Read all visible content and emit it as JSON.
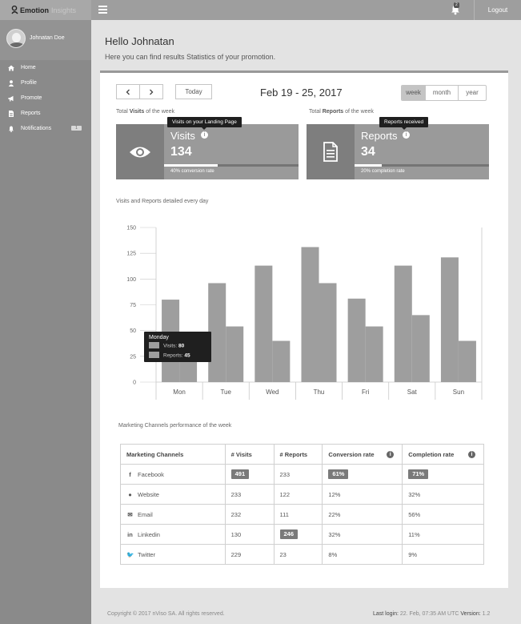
{
  "brand": {
    "name": "Emotion",
    "suffix": "Insights"
  },
  "topbar": {
    "notifications_count": "2",
    "logout_label": "Logout"
  },
  "sidebar": {
    "user_name": "Johnatan Doe",
    "items": [
      {
        "label": "Home",
        "icon": "home-icon"
      },
      {
        "label": "Profile",
        "icon": "user-icon"
      },
      {
        "label": "Promote",
        "icon": "megaphone-icon"
      },
      {
        "label": "Reports",
        "icon": "report-icon"
      },
      {
        "label": "Notifications",
        "icon": "bell-icon",
        "badge": "1"
      }
    ]
  },
  "header": {
    "title": "Hello Johnatan",
    "subtitle": "Here you can find results Statistics of your promotion."
  },
  "controls": {
    "prev": "‹",
    "next": "›",
    "today": "Today",
    "date_range": "Feb 19 - 25, 2017",
    "periods": [
      "week",
      "month",
      "year"
    ],
    "active_period": "week"
  },
  "visits": {
    "total_label_pre": "Total ",
    "total_label_bold": "Visits",
    "total_label_post": " of the week",
    "title": "Visits",
    "value": "134",
    "caption": "40% conversion rate",
    "progress": 0.4,
    "tooltip": "Visits on your Landing Page"
  },
  "reports": {
    "total_label_pre": "Total ",
    "total_label_bold": "Reports",
    "total_label_post": " of the week",
    "title": "Reports",
    "value": "34",
    "caption": "20% completion rate",
    "progress": 0.2,
    "tooltip": "Reports received"
  },
  "chart_title": "Visits and Reports detailed every day",
  "chart_data": {
    "type": "bar",
    "categories": [
      "Mon",
      "Tue",
      "Wed",
      "Thu",
      "Fri",
      "Sat",
      "Sun"
    ],
    "series": [
      {
        "name": "Visits",
        "values": [
          80,
          96,
          113,
          131,
          81,
          113,
          121
        ],
        "color": "#9e9e9e"
      },
      {
        "name": "Reports",
        "values": [
          45,
          54,
          40,
          96,
          54,
          65,
          40
        ],
        "color": "#9e9e9e"
      }
    ],
    "ylim": [
      0,
      150
    ],
    "yticks": [
      0,
      25,
      50,
      75,
      100,
      125,
      150
    ],
    "grid": false,
    "tooltip": {
      "day": "Monday",
      "rows": [
        {
          "label": "Visits:",
          "value": "80"
        },
        {
          "label": "Reports:",
          "value": "45"
        }
      ]
    }
  },
  "table": {
    "title": "Marketing Channels performance of the week",
    "headers": [
      "Marketing Channels",
      "# Visits",
      "# Reports",
      "Conversion rate",
      "Completion rate"
    ],
    "rows": [
      {
        "channel": "Facebook",
        "icon": "f",
        "visits": "491",
        "reports": "233",
        "conversion": "61%",
        "completion": "71%",
        "hl": [
          true,
          false,
          true,
          true
        ]
      },
      {
        "channel": "Website",
        "icon": "●",
        "visits": "233",
        "reports": "122",
        "conversion": "12%",
        "completion": "32%",
        "hl": [
          false,
          false,
          false,
          false
        ]
      },
      {
        "channel": "Email",
        "icon": "✉",
        "visits": "232",
        "reports": "111",
        "conversion": "22%",
        "completion": "56%",
        "hl": [
          false,
          false,
          false,
          false
        ]
      },
      {
        "channel": "Linkedin",
        "icon": "in",
        "visits": "130",
        "reports": "246",
        "conversion": "32%",
        "completion": "11%",
        "hl": [
          false,
          true,
          false,
          false
        ]
      },
      {
        "channel": "Twitter",
        "icon": "🐦",
        "visits": "229",
        "reports": "23",
        "conversion": "8%",
        "completion": "9%",
        "hl": [
          false,
          false,
          false,
          false
        ]
      }
    ]
  },
  "footer": {
    "copyright": "Copyright © 2017 nViso SA. All rights reserved.",
    "last_login_label": "Last login:",
    "last_login_value": "22. Feb, 07:35 AM UTC",
    "version_label": "Version:",
    "version_value": "1.2"
  }
}
